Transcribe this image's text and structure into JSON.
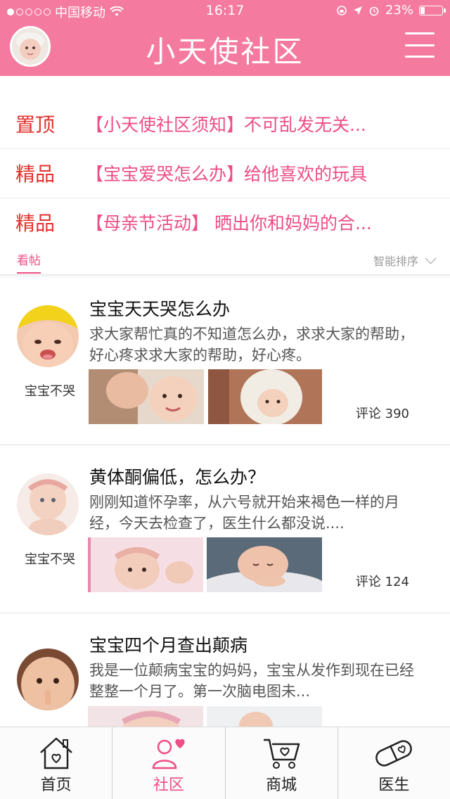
{
  "status": {
    "carrier": "中国移动",
    "time": "16:17",
    "battery": "23%",
    "battery_level": 0.23
  },
  "header": {
    "title": "小天使社区"
  },
  "pinned": [
    {
      "tag": "置顶",
      "title": "【小天使社区须知】不可乱发无关..."
    },
    {
      "tag": "精品",
      "title": "【宝宝爱哭怎么办】给他喜欢的玩具"
    },
    {
      "tag": "精品",
      "title": "【母亲节活动】 晒出你和妈妈的合..."
    }
  ],
  "tabs": {
    "view": "看帖",
    "sort": "智能排序"
  },
  "posts": [
    {
      "author": "宝宝不哭",
      "title": "宝宝天天哭怎么办",
      "excerpt": "求大家帮忙真的不知道怎么办，求求大家的帮助，好心疼求求大家的帮助，好心疼。",
      "comments": "评论 390"
    },
    {
      "author": "宝宝不哭",
      "title": "黄体酮偏低，怎么办？",
      "excerpt": "刚刚知道怀孕率，从六号就开始来褐色一样的月经，今天去检查了，医生什么都没说....",
      "comments": "评论 124"
    },
    {
      "author": "",
      "title": "宝宝四个月查出颠病",
      "excerpt": "我是一位颠病宝宝的妈妈，宝宝从发作到现在已经整整一个月了。第一次脑电图未...",
      "comments": ""
    }
  ],
  "nav": {
    "home": "首页",
    "community": "社区",
    "mall": "商城",
    "doctor": "医生"
  },
  "colors": {
    "brand": "#f47aa0",
    "accent": "#ee4d85",
    "tag_red": "#e3302e"
  }
}
